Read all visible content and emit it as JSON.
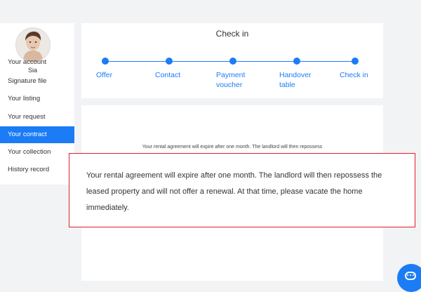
{
  "user": {
    "name": "Sia"
  },
  "sidebar": {
    "items": [
      {
        "label": "Your account"
      },
      {
        "label": "Signature file"
      },
      {
        "label": "Your listing"
      },
      {
        "label": "Your request"
      },
      {
        "label": "Your contract",
        "active": true
      },
      {
        "label": "Your collection"
      },
      {
        "label": "History record"
      }
    ]
  },
  "stepper": {
    "title": "Check in",
    "steps": [
      {
        "label": "Offer"
      },
      {
        "label": "Contact"
      },
      {
        "label": "Payment voucher"
      },
      {
        "label": "Handover table"
      },
      {
        "label": "Check in"
      }
    ]
  },
  "content": {
    "faint_notice": "Your rental agreement will expire after one month. The landlord will then repossess",
    "notice": "Your rental agreement will expire after one month. The landlord will then repossess the leased property and will not offer a renewal. At that time, please vacate the home immediately."
  },
  "icons": {
    "chat": "chat-bubble-icon",
    "avatar": "user-avatar"
  },
  "colors": {
    "accent": "#1b7cf6",
    "highlight_border": "#e0202a",
    "background": "#f2f3f5"
  }
}
